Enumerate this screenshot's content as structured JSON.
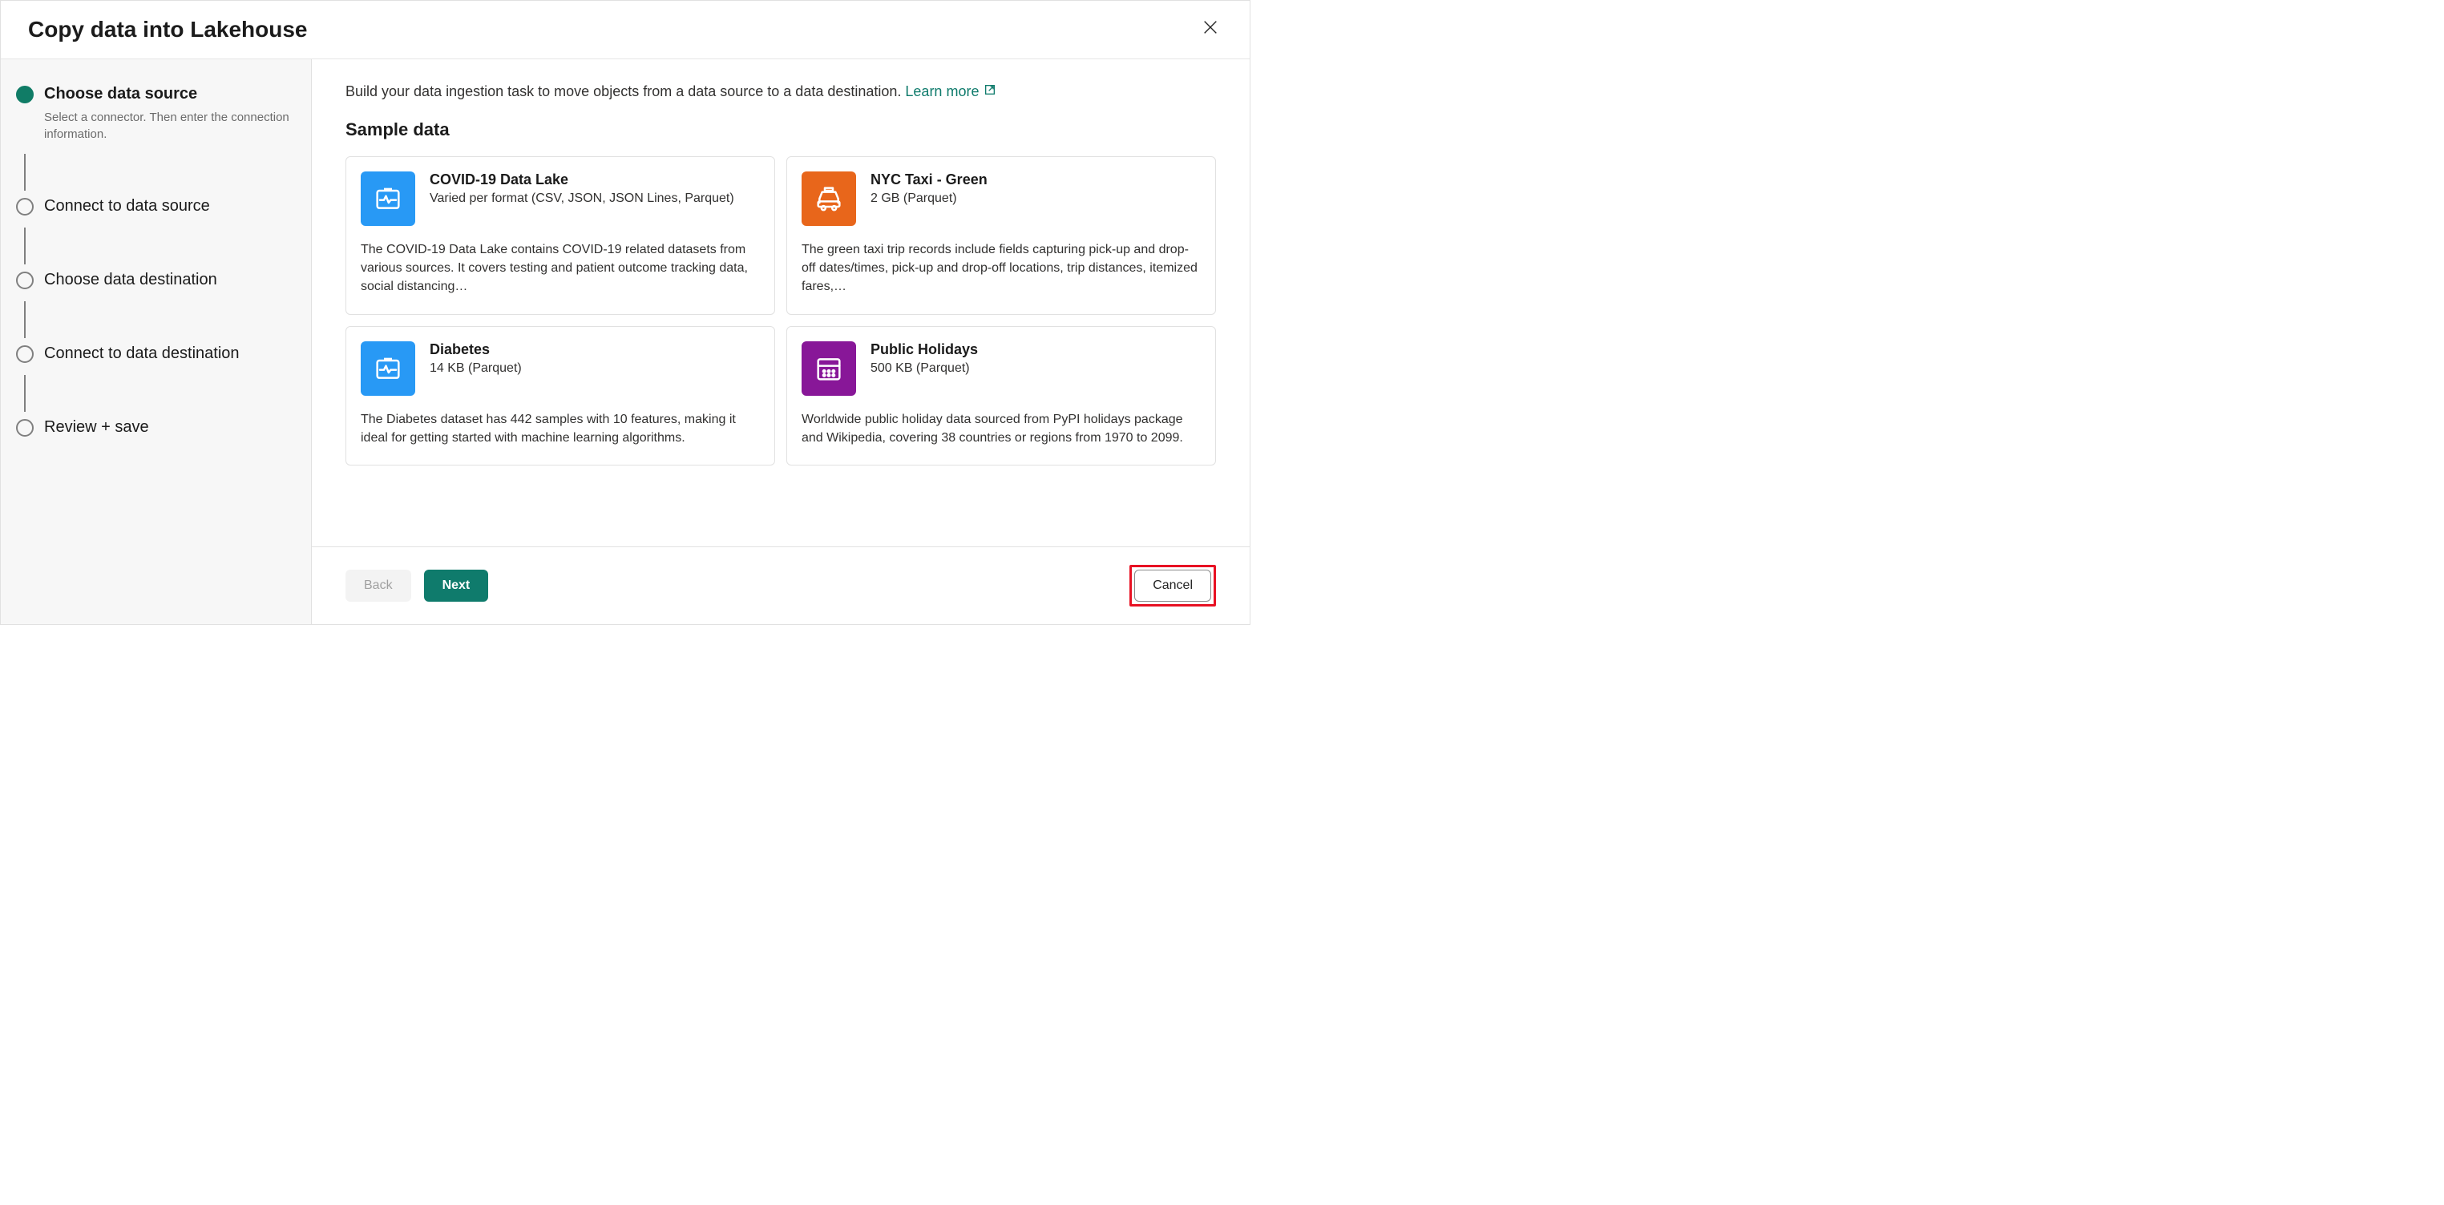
{
  "header": {
    "title": "Copy data into Lakehouse"
  },
  "sidebar": {
    "steps": [
      {
        "title": "Choose data source",
        "desc": "Select a connector. Then enter the connection information.",
        "active": true
      },
      {
        "title": "Connect to data source",
        "desc": "",
        "active": false
      },
      {
        "title": "Choose data destination",
        "desc": "",
        "active": false
      },
      {
        "title": "Connect to data destination",
        "desc": "",
        "active": false
      },
      {
        "title": "Review + save",
        "desc": "",
        "active": false
      }
    ]
  },
  "main": {
    "intro": "Build your data ingestion task to move objects from a data source to a data destination. ",
    "learn_more": "Learn more",
    "section_title": "Sample data",
    "cards": [
      {
        "title": "COVID-19 Data Lake",
        "subtitle": "Varied per format (CSV, JSON, JSON Lines, Parquet)",
        "desc": "The COVID-19 Data Lake contains COVID-19 related datasets from various sources. It covers testing and patient outcome tracking data, social distancing…",
        "icon": "monitor",
        "color": "blue"
      },
      {
        "title": "NYC Taxi - Green",
        "subtitle": "2 GB (Parquet)",
        "desc": "The green taxi trip records include fields capturing pick-up and drop-off dates/times, pick-up and drop-off locations, trip distances, itemized fares,…",
        "icon": "taxi",
        "color": "orange"
      },
      {
        "title": "Diabetes",
        "subtitle": "14 KB (Parquet)",
        "desc": "The Diabetes dataset has 442 samples with 10 features, making it ideal for getting started with machine learning algorithms.",
        "icon": "monitor",
        "color": "blue"
      },
      {
        "title": "Public Holidays",
        "subtitle": "500 KB (Parquet)",
        "desc": "Worldwide public holiday data sourced from PyPI holidays package and Wikipedia, covering 38 countries or regions from 1970 to 2099.",
        "icon": "calendar",
        "color": "purple"
      }
    ]
  },
  "footer": {
    "back": "Back",
    "next": "Next",
    "cancel": "Cancel"
  }
}
